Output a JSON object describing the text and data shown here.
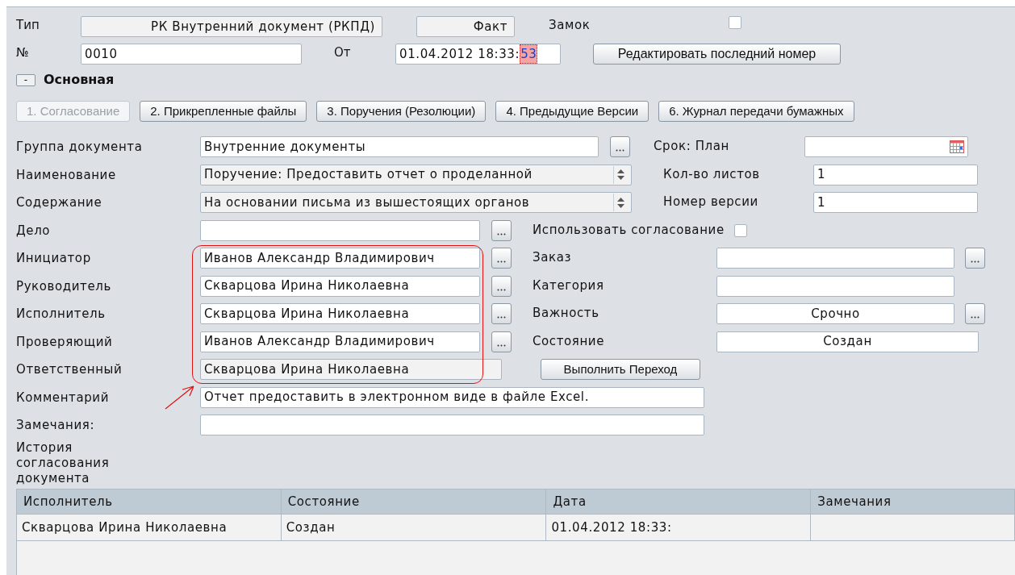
{
  "header": {
    "type_label": "Тип",
    "type_value": "РК Внутренний документ (РКПД)",
    "mode_value": "Факт",
    "lock_label": "Замок",
    "lock_checked": false,
    "number_label": "№",
    "number_value": "0010",
    "date_label": "От",
    "date_value": "01.04.2012 18:33:",
    "date_selected_part": "53",
    "edit_number_button": "Редактировать последний номер"
  },
  "section": {
    "toggle": "-",
    "title": "Основная",
    "expanded": true
  },
  "tabs": [
    {
      "label": "1. Согласование",
      "selected": true
    },
    {
      "label": "2. Прикрепленные файлы",
      "selected": false
    },
    {
      "label": "3. Поручения (Резолюции)",
      "selected": false
    },
    {
      "label": "4. Предыдущие Версии",
      "selected": false
    },
    {
      "label": "6. Журнал передачи бумажных",
      "selected": false
    }
  ],
  "rows": [
    {
      "label": "Группа документа",
      "value": "Внутренние документы",
      "kind": "lookup",
      "right": {
        "kind": "date",
        "label": "Срок: План"
      }
    },
    {
      "label": "Наименование",
      "value": "Поручение: Предоставить отчет о проделанной",
      "kind": "spinner",
      "right": {
        "kind": "text",
        "label": "Кол-во листов",
        "value": "1"
      }
    },
    {
      "label": "Содержание",
      "value": "На основании письма из вышестоящих органов",
      "kind": "spinner",
      "right": {
        "kind": "text",
        "label": "Номер версии",
        "value": "1"
      }
    },
    {
      "label": "Дело",
      "kind": "lookup",
      "right": {
        "kind": "checkbox",
        "label": "Использовать согласование",
        "checked": false
      }
    },
    {
      "label": "Инициатор",
      "value": "Иванов Александр Владимирович",
      "kind": "lookup",
      "right": {
        "kind": "lookup",
        "label": "Заказ"
      }
    },
    {
      "label": "Руководитель",
      "value": "Скварцова Ирина Николаевна",
      "kind": "lookup",
      "right": {
        "kind": "text",
        "label": "Категория"
      }
    },
    {
      "label": "Исполнитель",
      "value": "Скварцова Ирина Николаевна",
      "kind": "lookup",
      "right": {
        "kind": "lookup",
        "label": "Важность",
        "value": "Срочно",
        "centered": true
      }
    },
    {
      "label": "Проверяющий",
      "value": "Иванов Александр Владимирович",
      "kind": "lookup",
      "right": {
        "kind": "text",
        "label": "Состояние",
        "value": "Создан",
        "centered": true
      }
    },
    {
      "label": "Ответственный",
      "value": "Скварцова Ирина Николаевна",
      "kind": "readonly",
      "right": {
        "kind": "button",
        "label": "Выполнить Переход"
      }
    },
    {
      "label": "Комментарий",
      "value": "Отчет предоставить в электронном виде в файле Excel.",
      "kind": "wide"
    },
    {
      "label": "Замечания:",
      "kind": "wide"
    }
  ],
  "history": {
    "label": "История согласования документа",
    "columns": [
      "Исполнитель",
      "Состояние",
      "Дата",
      "Замечания"
    ],
    "rows": [
      [
        "Скварцова Ирина Николаевна",
        "Создан",
        "01.04.2012 18:33:",
        ""
      ]
    ]
  }
}
